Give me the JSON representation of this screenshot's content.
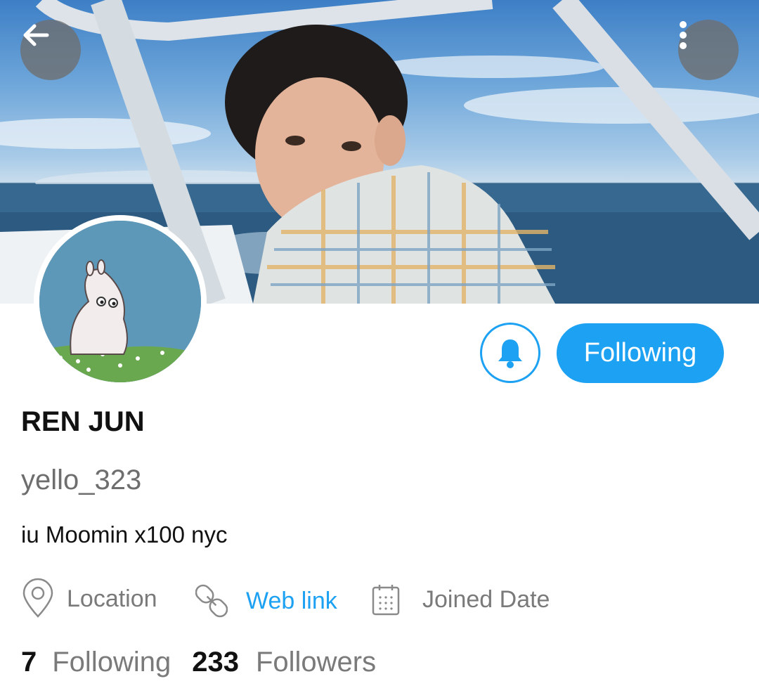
{
  "profile": {
    "display_name": "REN JUN",
    "handle": "yello_323",
    "bio": "iu Moomin x100 nyc"
  },
  "actions": {
    "follow_label": "Following"
  },
  "meta": {
    "location": "Location",
    "web_link": "Web link",
    "joined": "Joined Date"
  },
  "stats": {
    "following_count": "7",
    "following_label": "Following",
    "followers_count": "233",
    "followers_label": "Followers"
  },
  "icons": {
    "back": "arrow-left-icon",
    "more": "more-vertical-icon",
    "bell": "bell-icon",
    "location": "map-pin-icon",
    "link": "link-icon",
    "calendar": "calendar-icon"
  },
  "colors": {
    "accent": "#1da1f2",
    "secondary_text": "#7a7a7a",
    "primary_text": "#111111"
  }
}
